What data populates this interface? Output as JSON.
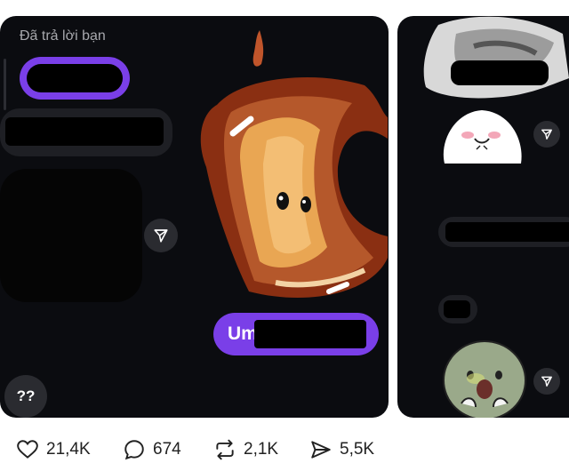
{
  "left_card": {
    "replied_label": "Đã trả lời bạn",
    "reply_text": "Um",
    "help_button_label": "??"
  },
  "stats": {
    "likes": "21,4K",
    "comments": "674",
    "reposts": "2,1K",
    "shares": "5,5K"
  },
  "colors": {
    "accent": "#7a3fe8",
    "card_bg": "#0b0c10",
    "bubble_bg": "#1e1f24"
  },
  "icons": {
    "like": "heart-icon",
    "comment": "comment-icon",
    "repost": "repost-icon",
    "share": "send-icon"
  }
}
